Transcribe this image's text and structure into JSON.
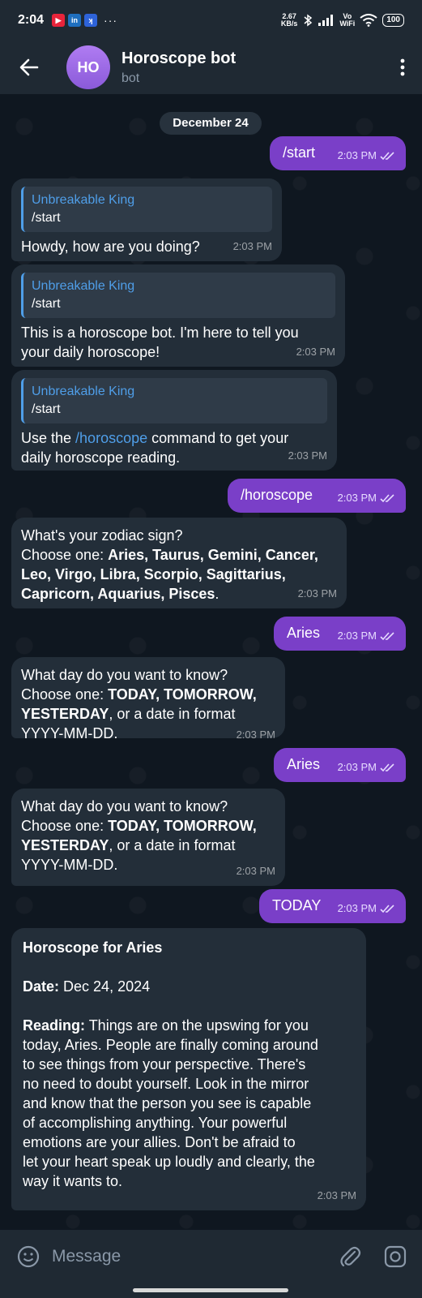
{
  "status": {
    "time": "2:04",
    "net_speed": "2.67",
    "net_unit": "KB/s",
    "volte": "Vo",
    "wifi_label": "WiFi",
    "battery": "100"
  },
  "header": {
    "avatar": "HO",
    "title": "Horoscope bot",
    "subtitle": "bot"
  },
  "chat": {
    "date": "December 24",
    "messages": [
      {
        "text": "/start",
        "time": "2:03 PM"
      },
      {
        "reply_author": "Unbreakable King",
        "reply_text": "/start",
        "text": "Howdy, how are you doing?",
        "time": "2:03 PM"
      },
      {
        "reply_author": "Unbreakable King",
        "reply_text": "/start",
        "text_l1": "This is a horoscope bot. I'm here to tell you",
        "text_l2": "your daily horoscope!",
        "time": "2:03 PM"
      },
      {
        "reply_author": "Unbreakable King",
        "reply_text": "/start",
        "pre": "Use the ",
        "cmd": "/horoscope",
        "post": " command to get your",
        "text_l2": "daily horoscope reading.",
        "time": "2:03 PM"
      },
      {
        "text": "/horoscope",
        "time": "2:03 PM"
      },
      {
        "line1": "What's your zodiac sign?",
        "line2_pre": "Choose one: ",
        "line2_signs": "Aries, Taurus, Gemini, Cancer,",
        "line3": "Leo, Virgo, Libra, Scorpio, Sagittarius,",
        "line4": "Capricorn, Aquarius, Pisces",
        "line4_end": ".",
        "time": "2:03 PM"
      },
      {
        "text": "Aries",
        "time": "2:03 PM"
      },
      {
        "line1": "What day do you want to know?",
        "line2_pre": "Choose one: ",
        "line2_bold": "TODAY, TOMORROW,",
        "line3_bold": "YESTERDAY",
        "line3_post": ", or a date in format",
        "line4": "YYYY-MM-DD.",
        "time": "2:03 PM"
      },
      {
        "text": "Aries",
        "time": "2:03 PM"
      },
      {
        "line1": "What day do you want to know?",
        "line2_pre": "Choose one: ",
        "line2_bold": "TODAY, TOMORROW,",
        "line3_bold": "YESTERDAY",
        "line3_post": ", or a date in format",
        "line4": "YYYY-MM-DD.",
        "time": "2:03 PM"
      },
      {
        "text": "TODAY",
        "time": "2:03 PM"
      },
      {
        "title": "Horoscope for Aries",
        "date_label": "Date:",
        "date_value": "Dec 24, 2024",
        "reading_label": "Reading:",
        "reading_lines": [
          " Things are on the upswing for you",
          "today, Aries. People are finally coming around",
          "to see things from your perspective. There's",
          "no need to doubt yourself. Look in the mirror",
          "and know that the person you see is capable",
          "of accomplishing anything. Your powerful",
          "emotions are your allies. Don't be afraid to",
          "let your heart speak up loudly and clearly, the",
          "way it wants to."
        ],
        "time": "2:03 PM"
      }
    ]
  },
  "input": {
    "placeholder": "Message"
  }
}
